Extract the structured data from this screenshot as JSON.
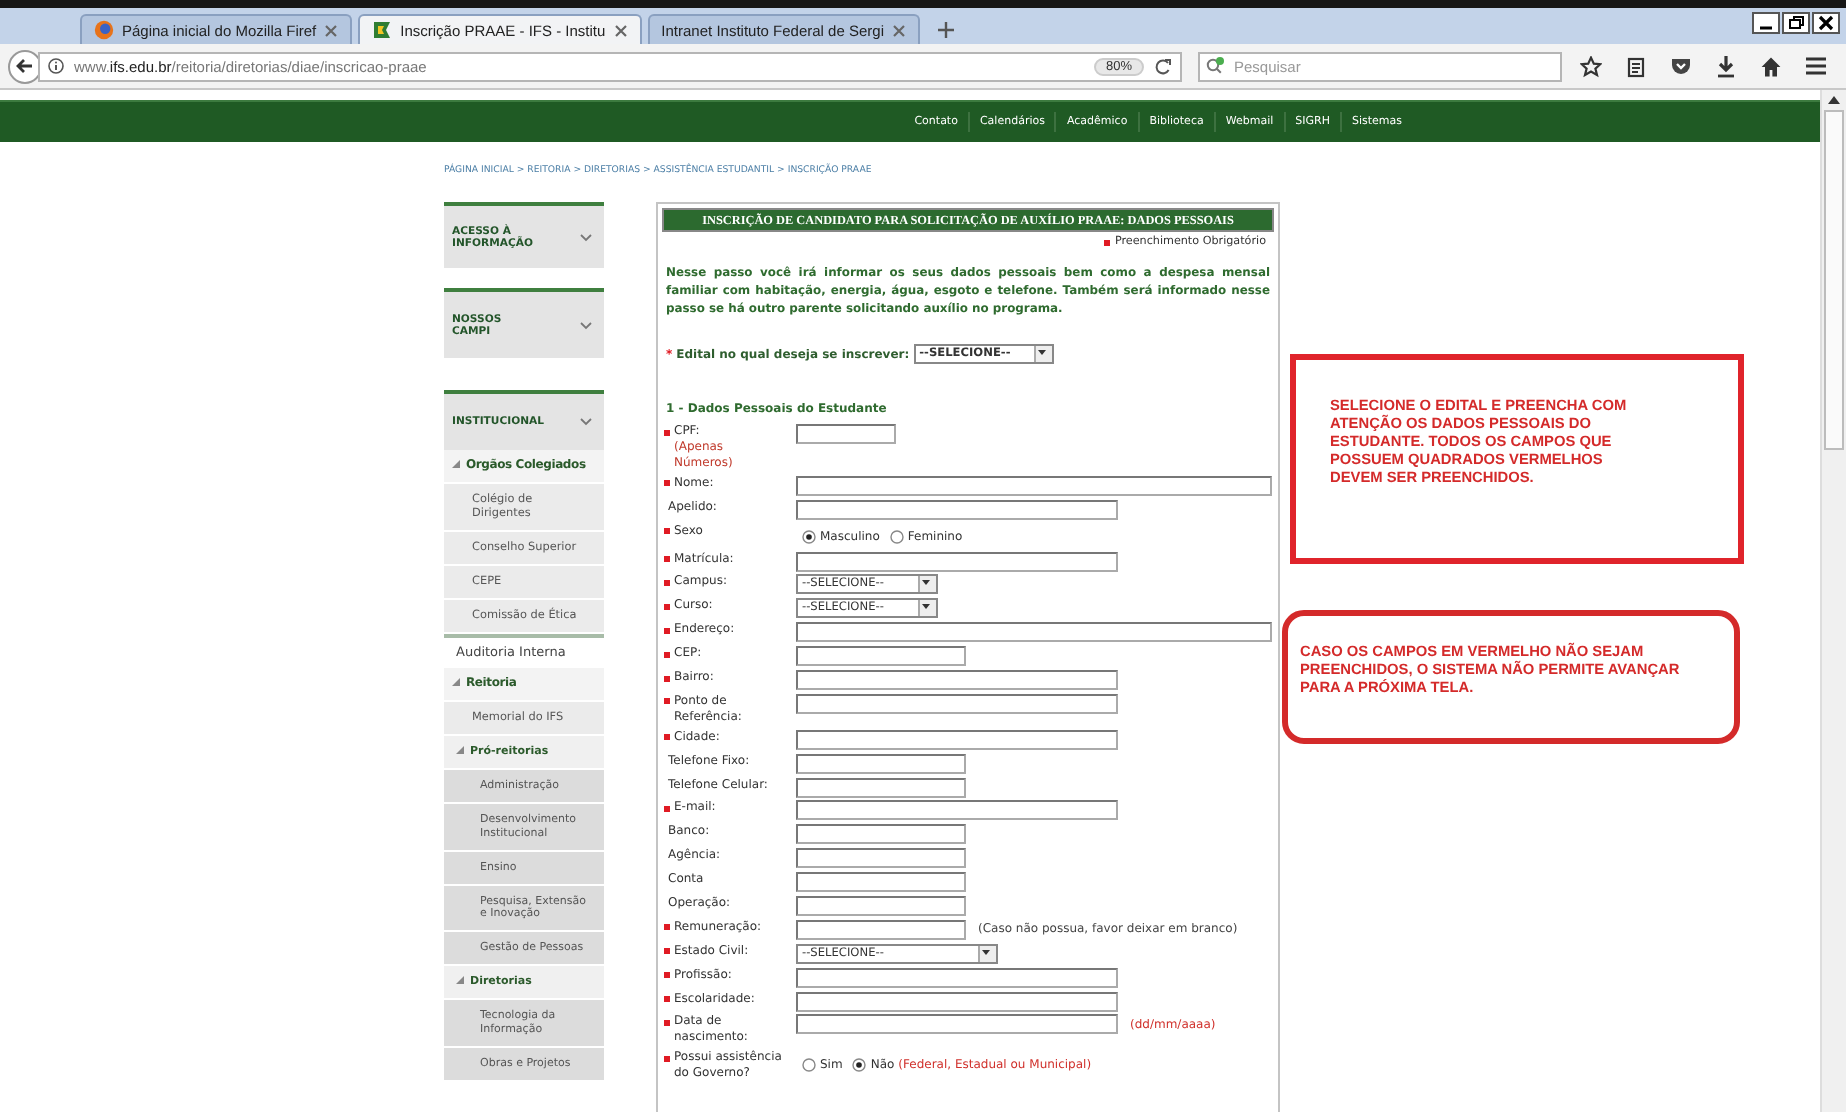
{
  "browser": {
    "tabs": [
      {
        "title": "Página inicial do Mozilla Firef",
        "selected": false
      },
      {
        "title": "Inscrição PRAAE - IFS - Institu",
        "selected": true
      },
      {
        "title": "Intranet Instituto Federal de Sergi",
        "selected": false
      }
    ],
    "url": "www.**ifs.edu.br**/reitoria/diretorias/diae/inscricao-praae",
    "zoom": "80%",
    "search": {
      "placeholder": "Pesquisar"
    }
  },
  "top_links": [
    "Contato",
    "Calendários",
    "Acadêmico",
    "Biblioteca",
    "Webmail",
    "SIGRH",
    "Sistemas"
  ],
  "breadcrumb": "PÁGINA INICIAL > REITORIA > DIRETORIAS > ASSISTÊNCIA ESTUDANTIL > INSCRIÇÃO PRAAE",
  "sidebar": {
    "panels": [
      {
        "title": "ACESSO À INFORMAÇÃO"
      },
      {
        "title": "NOSSOS CAMPI"
      },
      {
        "title": "INSTITUCIONAL",
        "items": [
          {
            "label": "Orgãos Colegiados",
            "expanded": true,
            "children": [
              {
                "label": "Colégio de Dirigentes"
              },
              {
                "label": "Conselho Superior"
              },
              {
                "label": "CEPE"
              },
              {
                "label": "Comissão de Ética"
              }
            ]
          },
          {
            "label": "Auditoria Interna"
          },
          {
            "label": "Reitoria",
            "expanded": true,
            "children": [
              {
                "label": "Memorial do IFS"
              },
              {
                "label": "Pró-reitorias",
                "expanded": true,
                "children": [
                  {
                    "label": "Administração"
                  },
                  {
                    "label": "Desenvolvimento Institucional"
                  },
                  {
                    "label": "Ensino"
                  },
                  {
                    "label": "Pesquisa, Extensão e Inovação"
                  },
                  {
                    "label": "Gestão de Pessoas"
                  }
                ]
              },
              {
                "label": "Diretorias",
                "expanded": true,
                "children": [
                  {
                    "label": "Tecnologia da Informação"
                  },
                  {
                    "label": "Obras e Projetos"
                  }
                ]
              }
            ]
          }
        ]
      }
    ]
  },
  "form": {
    "title": "INSCRIÇÃO DE CANDIDATO PARA SOLICITAÇÃO DE AUXÍLIO PRAAE: DADOS PESSOAIS",
    "required_legend": "Preenchimento Obrigatório",
    "intro": "Nesse passo você irá informar os seus dados pessoais bem como a despesa mensal familiar com habitação, energia, água, esgoto e telefone. Também será informado nesse passo se há outro parente solicitando auxílio no programa.",
    "edital": {
      "mark": "*",
      "label": "Edital no qual deseja se inscrever:",
      "value": "--SELECIONE--"
    },
    "section": "1 - Dados Pessoais do Estudante",
    "fields": [
      {
        "label": "CPF:",
        "note": "(Apenas Números)",
        "required": true,
        "kind": "text"
      },
      {
        "label": "Nome:",
        "required": true,
        "kind": "text"
      },
      {
        "label": "Apelido:",
        "required": false,
        "kind": "text"
      },
      {
        "label": "Sexo",
        "required": true,
        "kind": "radio",
        "options": [
          {
            "label": "Masculino",
            "selected": true
          },
          {
            "label": "Feminino",
            "selected": false
          }
        ]
      },
      {
        "label": "Matrícula:",
        "required": true,
        "kind": "text"
      },
      {
        "label": "Campus:",
        "required": true,
        "kind": "select",
        "value": "--SELECIONE--"
      },
      {
        "label": "Curso:",
        "required": true,
        "kind": "select",
        "value": "--SELECIONE--"
      },
      {
        "label": "Endereço:",
        "required": true,
        "kind": "text"
      },
      {
        "label": "CEP:",
        "required": true,
        "kind": "text"
      },
      {
        "label": "Bairro:",
        "required": true,
        "kind": "text"
      },
      {
        "label": "Ponto de Referência:",
        "required": true,
        "kind": "text"
      },
      {
        "label": "Cidade:",
        "required": true,
        "kind": "text"
      },
      {
        "label": "Telefone Fixo:",
        "required": false,
        "kind": "text"
      },
      {
        "label": "Telefone Celular:",
        "required": false,
        "kind": "text"
      },
      {
        "label": "E-mail:",
        "required": true,
        "kind": "text"
      },
      {
        "label": "Banco:",
        "required": false,
        "kind": "text"
      },
      {
        "label": "Agência:",
        "required": false,
        "kind": "text"
      },
      {
        "label": "Conta",
        "required": false,
        "kind": "text"
      },
      {
        "label": "Operação:",
        "required": false,
        "kind": "text"
      },
      {
        "label": "Remuneração:",
        "required": true,
        "kind": "text",
        "hint": "(Caso não possua, favor deixar em branco)"
      },
      {
        "label": "Estado Civil:",
        "required": true,
        "kind": "select",
        "value": "--SELECIONE--"
      },
      {
        "label": "Profissão:",
        "required": true,
        "kind": "text"
      },
      {
        "label": "Escolaridade:",
        "required": true,
        "kind": "text"
      },
      {
        "label": "Data de nascimento:",
        "required": true,
        "kind": "text",
        "hint": "(dd/mm/aaaa)"
      },
      {
        "label": "Possui assistência do Governo?",
        "required": true,
        "kind": "radio",
        "options": [
          {
            "label": "Sim",
            "selected": false
          },
          {
            "label": "Não",
            "selected": true
          }
        ],
        "hint": "(Federal, Estadual ou Municipal)"
      }
    ]
  },
  "notes": [
    {
      "text": "SELECIONE O EDITAL E PREENCHA COM ATENÇÃO OS DADOS PESSOAIS DO ESTUDANTE. TODOS OS CAMPOS QUE POSSUEM QUADRADOS VERMELHOS DEVEM SER PREENCHIDOS.",
      "kind": "box"
    },
    {
      "text": "CASO OS CAMPOS EM VERMELHO NÃO SEJAM PREENCHIDOS, O SISTEMA NÃO PERMITE AVANÇAR PARA A PRÓXIMA TELA.",
      "kind": "rounded"
    }
  ]
}
